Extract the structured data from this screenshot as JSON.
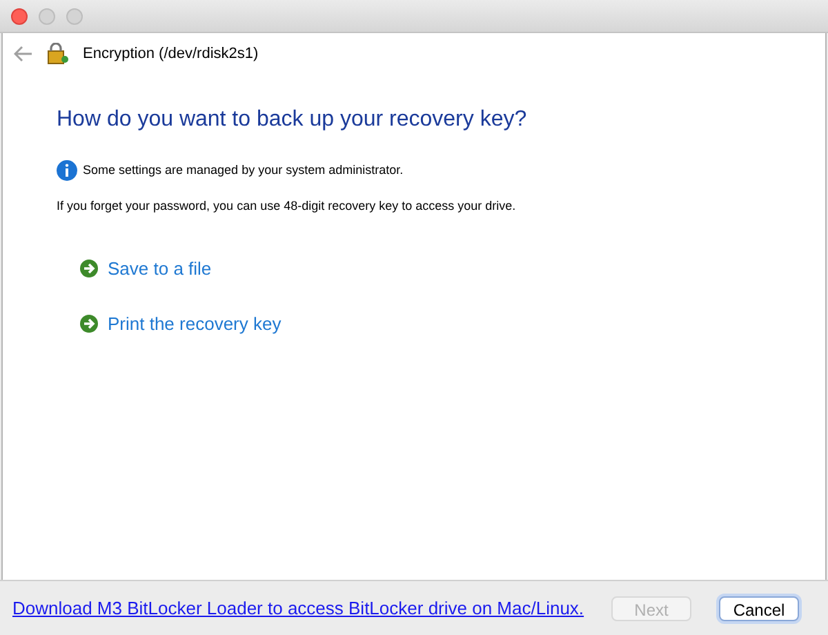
{
  "window": {
    "title": "Encryption (/dev/rdisk2s1)"
  },
  "heading": "How do you want to back up your recovery key?",
  "notice": "Some settings are managed by your system administrator.",
  "description": "If you forget your password, you can use 48-digit recovery key to access your drive.",
  "options": [
    {
      "label": "Save to a file"
    },
    {
      "label": "Print the recovery key"
    }
  ],
  "footer_link": "Download M3 BitLocker Loader to access BitLocker drive on Mac/Linux.",
  "buttons": [
    {
      "label": "Next",
      "disabled": true,
      "default": false
    },
    {
      "label": "Cancel",
      "disabled": false,
      "default": true
    }
  ]
}
